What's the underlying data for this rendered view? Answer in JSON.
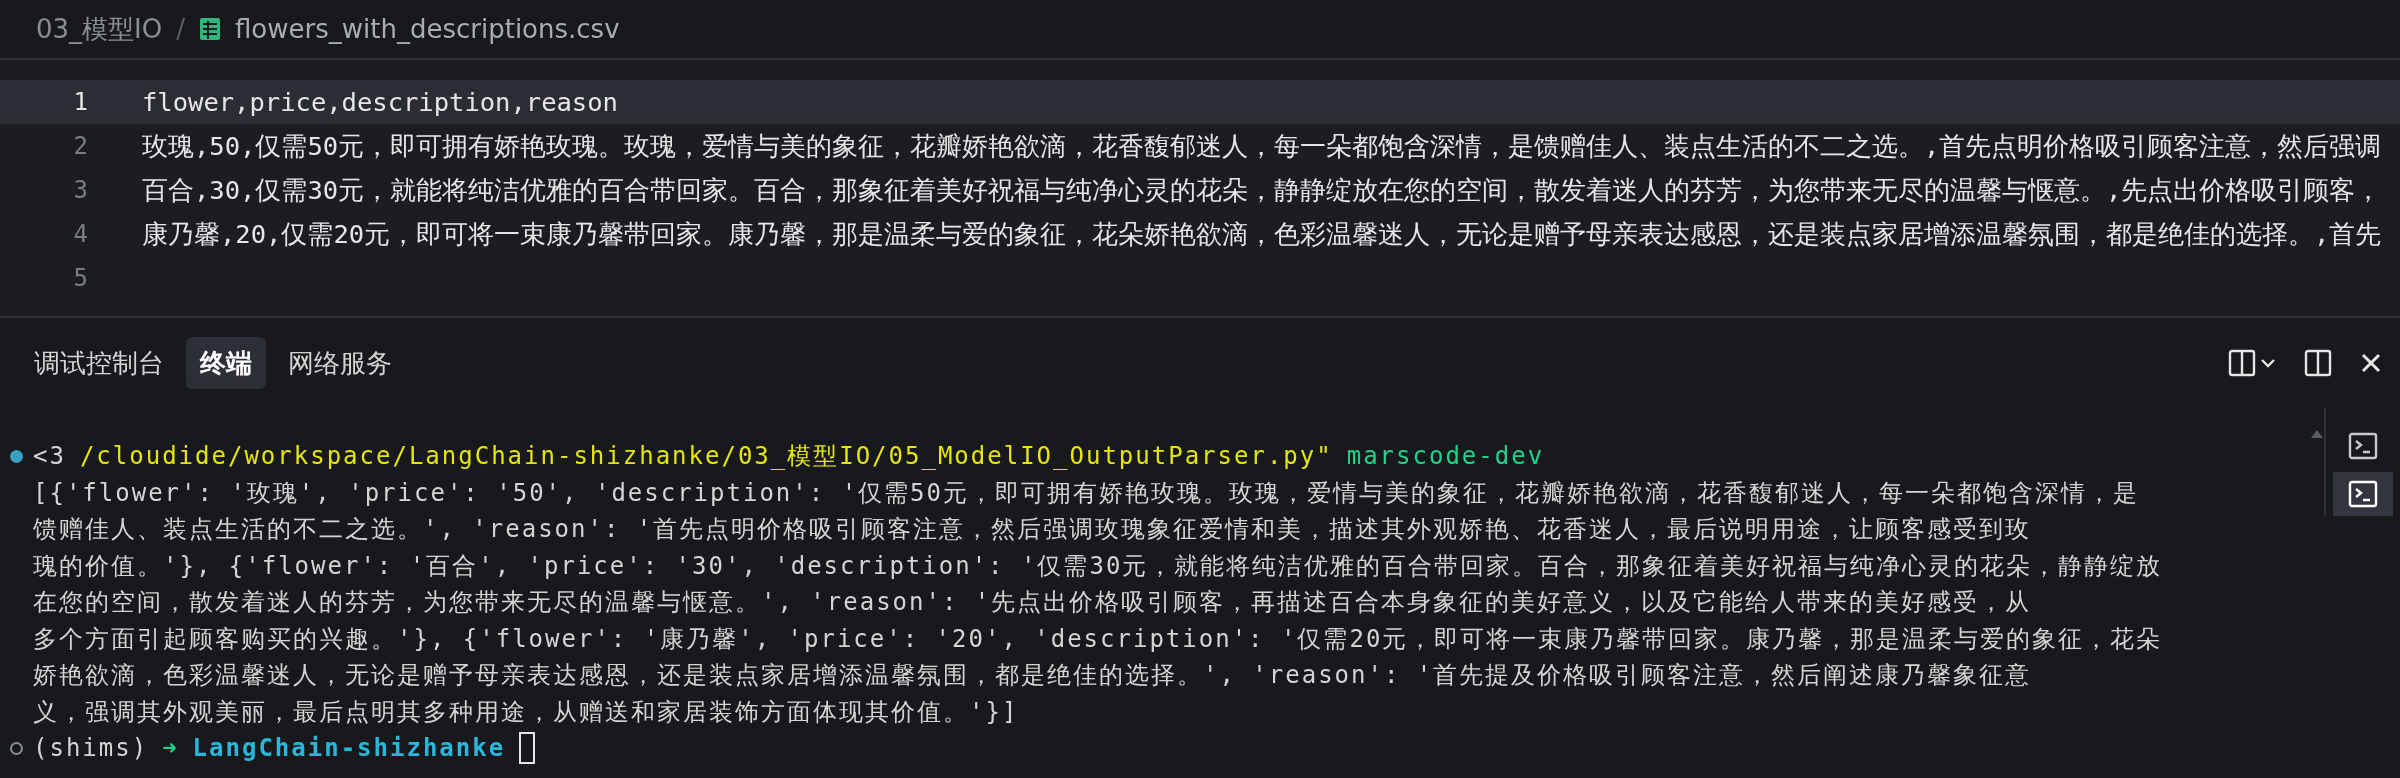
{
  "breadcrumb": {
    "folder": "03_模型IO",
    "separator": "/",
    "file": "flowers_with_descriptions.csv"
  },
  "editor": {
    "lines": [
      {
        "number": "1",
        "text": "flower,price,description,reason",
        "current": true
      },
      {
        "number": "2",
        "text": "玫瑰,50,仅需50元，即可拥有娇艳玫瑰。玫瑰，爱情与美的象征，花瓣娇艳欲滴，花香馥郁迷人，每一朵都饱含深情，是馈赠佳人、装点生活的不二之选。,首先点明价格吸引顾客注意，然后强调",
        "current": false
      },
      {
        "number": "3",
        "text": "百合,30,仅需30元，就能将纯洁优雅的百合带回家。百合，那象征着美好祝福与纯净心灵的花朵，静静绽放在您的空间，散发着迷人的芬芳，为您带来无尽的温馨与惬意。,先点出价格吸引顾客，",
        "current": false
      },
      {
        "number": "4",
        "text": "康乃馨,20,仅需20元，即可将一束康乃馨带回家。康乃馨，那是温柔与爱的象征，花朵娇艳欲滴，色彩温馨迷人，无论是赠予母亲表达感恩，还是装点家居增添温馨氛围，都是绝佳的选择。,首先",
        "current": false
      },
      {
        "number": "5",
        "current": false
      }
    ]
  },
  "panel": {
    "tabs": [
      {
        "label": "调试控制台",
        "selected": false
      },
      {
        "label": "终端",
        "selected": true
      },
      {
        "label": "网络服务",
        "selected": false
      }
    ]
  },
  "terminal": {
    "lines": [
      {
        "kind": "command",
        "segments": [
          {
            "kind": "plain",
            "text": "<3"
          },
          {
            "kind": "path",
            "text": "/cloudide/workspace/LangChain-shizhanke/03_模型IO/05_ModelIO_OutputParser.py\""
          },
          {
            "kind": "branch",
            "text": "marscode-dev"
          }
        ]
      },
      {
        "segments": [
          {
            "kind": "plain",
            "text": "[{'flower': '玫瑰', 'price': '50', 'description': '仅需50元，即可拥有娇艳玫瑰。玫瑰，爱情与美的象征，花瓣娇艳欲滴，花香馥郁迷人，每一朵都饱含深情，是"
          }
        ]
      },
      {
        "segments": [
          {
            "kind": "plain",
            "text": "馈赠佳人、装点生活的不二之选。', 'reason': '首先点明价格吸引顾客注意，然后强调玫瑰象征爱情和美，描述其外观娇艳、花香迷人，最后说明用途，让顾客感受到玫"
          }
        ]
      },
      {
        "segments": [
          {
            "kind": "plain",
            "text": "瑰的价值。'}, {'flower': '百合', 'price': '30', 'description': '仅需30元，就能将纯洁优雅的百合带回家。百合，那象征着美好祝福与纯净心灵的花朵，静静绽放"
          }
        ]
      },
      {
        "segments": [
          {
            "kind": "plain",
            "text": "在您的空间，散发着迷人的芬芳，为您带来无尽的温馨与惬意。', 'reason': '先点出价格吸引顾客，再描述百合本身象征的美好意义，以及它能给人带来的美好感受，从"
          }
        ]
      },
      {
        "segments": [
          {
            "kind": "plain",
            "text": "多个方面引起顾客购买的兴趣。'}, {'flower': '康乃馨', 'price': '20', 'description': '仅需20元，即可将一束康乃馨带回家。康乃馨，那是温柔与爱的象征，花朵"
          }
        ]
      },
      {
        "segments": [
          {
            "kind": "plain",
            "text": "娇艳欲滴，色彩温馨迷人，无论是赠予母亲表达感恩，还是装点家居增添温馨氛围，都是绝佳的选择。', 'reason': '首先提及价格吸引顾客注意，然后阐述康乃馨象征意"
          }
        ]
      },
      {
        "segments": [
          {
            "kind": "plain",
            "text": "义，强调其外观美丽，最后点明其多种用途，从赠送和家居装饰方面体现其价值。'}]"
          }
        ]
      },
      {
        "kind": "prompt",
        "cursor": true,
        "segments": [
          {
            "kind": "plain",
            "text": "(shims)"
          },
          {
            "kind": "arrow",
            "text": "➜"
          },
          {
            "kind": "dir",
            "text": "LangChain-shizhanke"
          }
        ]
      }
    ]
  },
  "terminal_list": [
    {
      "selected": false
    },
    {
      "selected": true
    }
  ]
}
